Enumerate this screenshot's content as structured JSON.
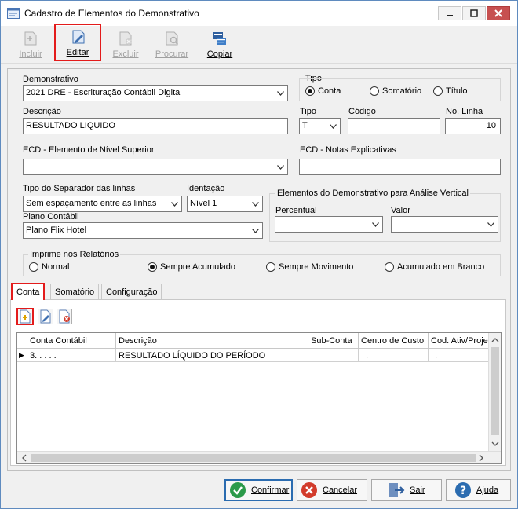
{
  "window": {
    "title": "Cadastro de Elementos do Demonstrativo"
  },
  "toolbar": {
    "incluir": "Incluir",
    "editar": "Editar",
    "excluir": "Excluir",
    "procurar": "Procurar",
    "copiar": "Copiar"
  },
  "form": {
    "demonstrativo_label": "Demonstrativo",
    "demonstrativo_value": "2021 DRE - Escrituração Contábil Digital",
    "tipo_group_label": "Tipo",
    "tipo_options": [
      "Conta",
      "Somatório",
      "Título"
    ],
    "tipo_selected": "Conta",
    "descricao_label": "Descrição",
    "descricao_value": "RESULTADO LIQUIDO",
    "tipo_label": "Tipo",
    "tipo_value": "T",
    "codigo_label": "Código",
    "codigo_value": "",
    "no_linha_label": "No. Linha",
    "no_linha_value": "10",
    "ecd_superior_label": "ECD - Elemento de Nível Superior",
    "ecd_superior_value": "",
    "ecd_notas_label": "ECD - Notas Explicativas",
    "ecd_notas_value": "",
    "separador_label": "Tipo do Separador das linhas",
    "separador_value": "Sem espaçamento entre as linhas",
    "identacao_label": "Identação",
    "identacao_value": "Nível 1",
    "plano_label": "Plano Contábil",
    "plano_value": "Plano Flix Hotel",
    "analise_group_label": "Elementos do Demonstrativo para Análise Vertical",
    "percentual_label": "Percentual",
    "percentual_value": "",
    "valor_label": "Valor",
    "valor_value": "",
    "imprime_group_label": "Imprime nos Relatórios",
    "imprime_options": [
      "Normal",
      "Sempre Acumulado",
      "Sempre Movimento",
      "Acumulado em Branco"
    ],
    "imprime_selected": "Sempre Acumulado"
  },
  "tabs": [
    "Conta",
    "Somatório",
    "Configuração"
  ],
  "grid": {
    "columns": [
      "Conta Contábil",
      "Descrição",
      "Sub-Conta",
      "Centro de Custo",
      "Cod. Ativ/Proje"
    ],
    "rows": [
      {
        "indicator": "▶",
        "conta": "3. .  .  .  .",
        "descricao": "RESULTADO LÍQUIDO DO PERÍODO",
        "subconta": "",
        "centro": ".",
        "cod": "."
      }
    ]
  },
  "buttons": {
    "confirmar": "Confirmar",
    "cancelar": "Cancelar",
    "sair": "Sair",
    "ajuda": "Ajuda"
  },
  "icons": {
    "incluir": "add-document-icon",
    "editar": "edit-document-icon",
    "excluir": "delete-document-icon",
    "procurar": "search-document-icon",
    "copiar": "copy-icon"
  },
  "colors": {
    "highlight": "#e31b1b",
    "confirm": "#2b9a4a",
    "cancel": "#d23b2b",
    "accent": "#2b6cb0"
  }
}
